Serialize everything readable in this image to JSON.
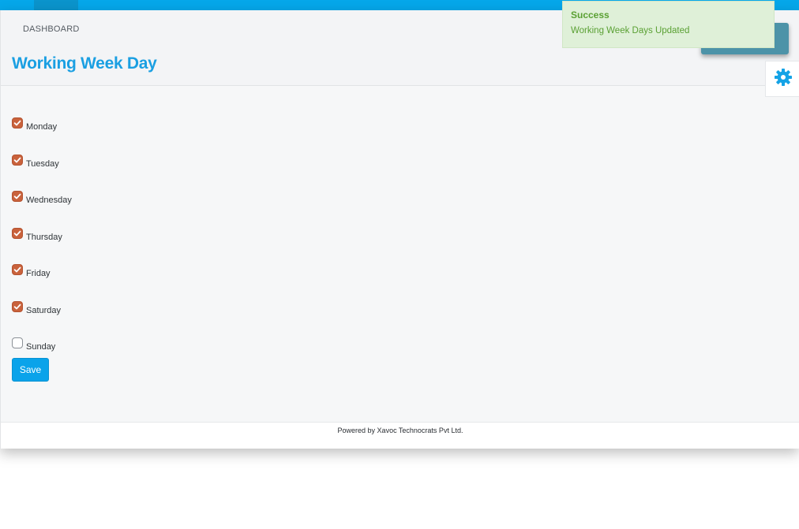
{
  "breadcrumb": "DASHBOARD",
  "page_title": "Working Week Day",
  "days": [
    {
      "label": "Monday",
      "checked": true
    },
    {
      "label": "Tuesday",
      "checked": true
    },
    {
      "label": "Wednesday",
      "checked": true
    },
    {
      "label": "Thursday",
      "checked": true
    },
    {
      "label": "Friday",
      "checked": true
    },
    {
      "label": "Saturday",
      "checked": true
    },
    {
      "label": "Sunday",
      "checked": false
    }
  ],
  "save_label": "Save",
  "footer_text": "Powered by Xavoc Technocrats Pvt Ltd.",
  "toast": {
    "title": "Success",
    "message": "Working Week Days Updated"
  },
  "icons": {
    "settings": "gear-icon",
    "checkbox_checked": "check-icon"
  },
  "colors": {
    "accent": "#05a7ea",
    "title": "#1a9fe2",
    "checkbox": "#c9623c",
    "toast_bg": "#dff0d8",
    "toast_text": "#5aa033"
  }
}
